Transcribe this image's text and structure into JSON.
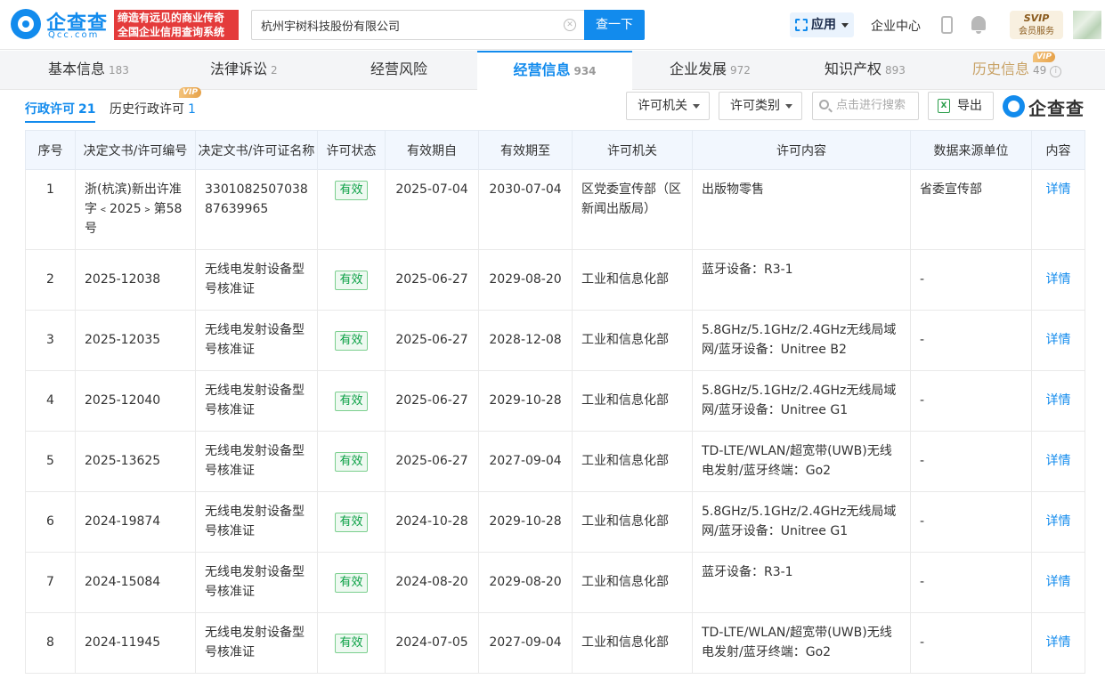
{
  "header": {
    "logo_text": "企查查",
    "logo_sub": "Qcc.com",
    "slogan_line1": "缔造有远见的商业传奇",
    "slogan_line2": "全国企业信用查询系统",
    "search_value": "杭州宇树科技股份有限公司",
    "search_button": "查一下",
    "app_button": "应用",
    "enterprise_center": "企业中心",
    "svip_label": "SVIP",
    "svip_sub": "会员服务"
  },
  "tabs": [
    {
      "label": "基本信息",
      "count": "183"
    },
    {
      "label": "法律诉讼",
      "count": "2"
    },
    {
      "label": "经营风险",
      "count": ""
    },
    {
      "label": "经营信息",
      "count": "934"
    },
    {
      "label": "企业发展",
      "count": "972"
    },
    {
      "label": "知识产权",
      "count": "893"
    },
    {
      "label": "历史信息",
      "count": "49",
      "badge": "VIP"
    }
  ],
  "subtabs": {
    "active_label": "行政许可",
    "active_count": "21",
    "other_label": "历史行政许可",
    "other_count": "1",
    "other_badge": "VIP"
  },
  "toolbar": {
    "filter_authority": "许可机关",
    "filter_category": "许可类别",
    "search_placeholder": "点击进行搜索",
    "export_label": "导出",
    "excel_glyph": "X",
    "watermark": "企查查"
  },
  "table": {
    "headers": [
      "序号",
      "决定文书/许可编号",
      "决定文书/许可证名称",
      "许可状态",
      "有效期自",
      "有效期至",
      "许可机关",
      "许可内容",
      "数据来源单位",
      "内容"
    ],
    "rows": [
      [
        "1",
        "浙(杭滨)新出许准字﹤2025﹥第58号",
        "330108250703887639965",
        "有效",
        "2025-07-04",
        "2030-07-04",
        "区党委宣传部（区新闻出版局）",
        "出版物零售",
        "省委宣传部",
        "详情"
      ],
      [
        "2",
        "2025-12038",
        "无线电发射设备型号核准证",
        "有效",
        "2025-06-27",
        "2029-08-20",
        "工业和信息化部",
        "蓝牙设备：R3-1",
        "-",
        "详情"
      ],
      [
        "3",
        "2025-12035",
        "无线电发射设备型号核准证",
        "有效",
        "2025-06-27",
        "2028-12-08",
        "工业和信息化部",
        "5.8GHz/5.1GHz/2.4GHz无线局域网/蓝牙设备：Unitree B2",
        "-",
        "详情"
      ],
      [
        "4",
        "2025-12040",
        "无线电发射设备型号核准证",
        "有效",
        "2025-06-27",
        "2029-10-28",
        "工业和信息化部",
        "5.8GHz/5.1GHz/2.4GHz无线局域网/蓝牙设备：Unitree G1",
        "-",
        "详情"
      ],
      [
        "5",
        "2025-13625",
        "无线电发射设备型号核准证",
        "有效",
        "2025-06-27",
        "2027-09-04",
        "工业和信息化部",
        "TD-LTE/WLAN/超宽带(UWB)无线电发射/蓝牙终端：Go2",
        "-",
        "详情"
      ],
      [
        "6",
        "2024-19874",
        "无线电发射设备型号核准证",
        "有效",
        "2024-10-28",
        "2029-10-28",
        "工业和信息化部",
        "5.8GHz/5.1GHz/2.4GHz无线局域网/蓝牙设备：Unitree G1",
        "-",
        "详情"
      ],
      [
        "7",
        "2024-15084",
        "无线电发射设备型号核准证",
        "有效",
        "2024-08-20",
        "2029-08-20",
        "工业和信息化部",
        "蓝牙设备：R3-1",
        "-",
        "详情"
      ],
      [
        "8",
        "2024-11945",
        "无线电发射设备型号核准证",
        "有效",
        "2024-07-05",
        "2027-09-04",
        "工业和信息化部",
        "TD-LTE/WLAN/超宽带(UWB)无线电发射/蓝牙终端：Go2",
        "-",
        "详情"
      ]
    ]
  },
  "colors": {
    "brand": "#128bed",
    "valid_green": "#0aa044",
    "slogan_red": "#e43b3b",
    "vip_gold": "#c8a266"
  }
}
